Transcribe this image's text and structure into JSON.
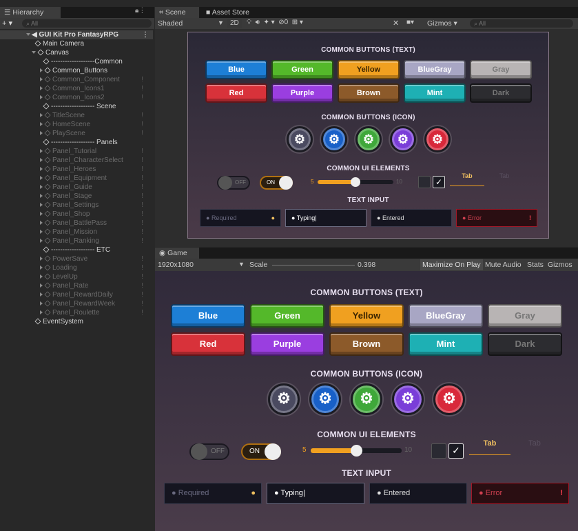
{
  "hierarchy": {
    "tab": "Hierarchy",
    "search_placeholder": "All",
    "add_label": "+ ▾",
    "root": "GUI Kit Pro FantasyRPG",
    "items": [
      {
        "label": "Main Camera",
        "dim": false
      },
      {
        "label": "Canvas",
        "dim": false
      },
      {
        "label": "-------------------Common",
        "dim": false
      },
      {
        "label": "Common_Buttons",
        "dim": false
      },
      {
        "label": "Common_Component",
        "dim": true
      },
      {
        "label": "Common_Icons1",
        "dim": true
      },
      {
        "label": "Common_Icons2",
        "dim": true
      },
      {
        "label": "------------------- Scene",
        "dim": false
      },
      {
        "label": "TitleScene",
        "dim": true
      },
      {
        "label": "HomeScene",
        "dim": true
      },
      {
        "label": "PlayScene",
        "dim": true
      },
      {
        "label": "------------------- Panels",
        "dim": false
      },
      {
        "label": "Panel_Tutorial",
        "dim": true
      },
      {
        "label": "Panel_CharacterSelect",
        "dim": true
      },
      {
        "label": "Panel_Heroes",
        "dim": true
      },
      {
        "label": "Panel_Equipment",
        "dim": true
      },
      {
        "label": "Panel_Guide",
        "dim": true
      },
      {
        "label": "Panel_Stage",
        "dim": true
      },
      {
        "label": "Panel_Settings",
        "dim": true
      },
      {
        "label": "Panel_Shop",
        "dim": true
      },
      {
        "label": "Panel_BattlePass",
        "dim": true
      },
      {
        "label": "Panel_Mission",
        "dim": true
      },
      {
        "label": "Panel_Ranking",
        "dim": true
      },
      {
        "label": "------------------- ETC",
        "dim": false
      },
      {
        "label": "PowerSave",
        "dim": true
      },
      {
        "label": "Loading",
        "dim": true
      },
      {
        "label": "LevelUp",
        "dim": true
      },
      {
        "label": "Panel_Rate",
        "dim": true
      },
      {
        "label": "Panel_RewardDaily",
        "dim": true
      },
      {
        "label": "Panel_RewardWeek",
        "dim": true
      },
      {
        "label": "Panel_Roulette",
        "dim": true
      },
      {
        "label": "EventSystem",
        "dim": false
      }
    ]
  },
  "scene": {
    "tab": "Scene",
    "tab2": "Asset Store",
    "shading": "Shaded",
    "mode_2d": "2D",
    "fx_count": "0",
    "gizmos": "Gizmos",
    "search_placeholder": "All"
  },
  "game": {
    "tab": "Game",
    "resolution": "1920x1080",
    "scale_label": "Scale",
    "scale_value": "0.398",
    "maximize": "Maximize On Play",
    "mute": "Mute Audio",
    "stats": "Stats",
    "gizmos": "Gizmos"
  },
  "ui": {
    "sec_text": "COMMON BUTTONS (TEXT)",
    "sec_icon": "COMMON BUTTONS (ICON)",
    "sec_elements": "COMMON UI ELEMENTS",
    "sec_input": "TEXT INPUT",
    "buttons": [
      {
        "label": "Blue",
        "color": "#1d7fd6"
      },
      {
        "label": "Green",
        "color": "#54b82a"
      },
      {
        "label": "Yellow",
        "color": "#f0a020"
      },
      {
        "label": "BlueGray",
        "color": "#a8a6c4"
      },
      {
        "label": "Gray",
        "color": "#b8b4b4"
      },
      {
        "label": "Red",
        "color": "#d8323a"
      },
      {
        "label": "Purple",
        "color": "#9a3ee0"
      },
      {
        "label": "Brown",
        "color": "#8c5a2a"
      },
      {
        "label": "Mint",
        "color": "#1eb0b4"
      },
      {
        "label": "Dark",
        "color": "#2c2c30"
      }
    ],
    "icon_colors": [
      "#4a4a60",
      "#1860c8",
      "#3fa83a",
      "#7a3ed8",
      "#d8283a"
    ],
    "toggle_off": "OFF",
    "toggle_on": "ON",
    "slider_min": "5",
    "slider_max": "10",
    "slider_value": 0.5,
    "tab_active": "Tab",
    "tab_inactive": "Tab",
    "inputs": [
      "Required",
      "Typing",
      "Entered",
      "Error"
    ]
  }
}
